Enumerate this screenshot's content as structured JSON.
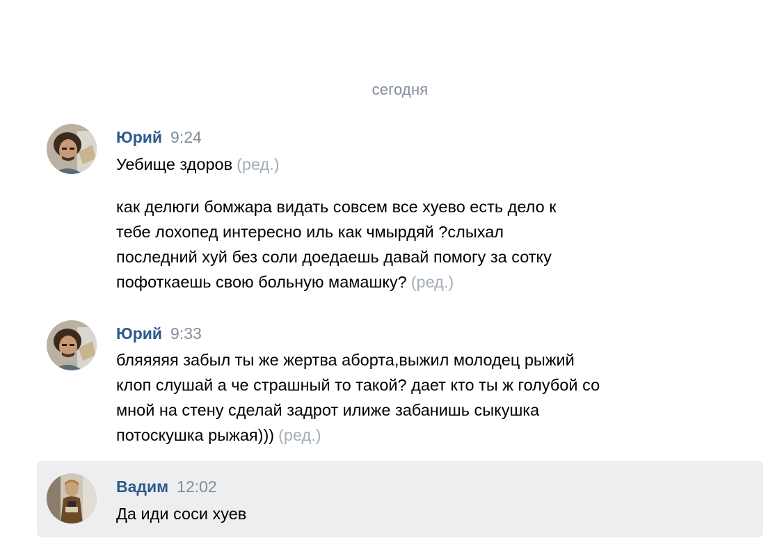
{
  "date_divider": "сегодня",
  "messages": [
    {
      "author": "Юрий",
      "time": "9:24",
      "texts": [
        {
          "text": "Уебище здоров",
          "edited": "(ред.)"
        },
        {
          "text": "как делюги бомжара видать совсем все хуево есть дело к\nтебе лохопед интересно иль как чмырдяй ?слыхал\nпоследний хуй без соли доедаешь давай помогу за сотку\nпофоткаешь свою больную мамашку?",
          "edited": "(ред.)"
        }
      ]
    },
    {
      "author": "Юрий",
      "time": "9:33",
      "texts": [
        {
          "text": "бляяяяя забыл ты же жертва аборта,выжил молодец рыжий\nклоп слушай а че страшный то такой? дает кто ты ж голубой со\nмной на стену сделай задрот илиже забанишь сыкушка\nпотоскушка рыжая)))",
          "edited": "(ред.)"
        }
      ]
    },
    {
      "author": "Вадим",
      "time": "12:02",
      "texts": [
        {
          "text": "Да иди соси хуев"
        }
      ]
    }
  ],
  "colors": {
    "author": "#2c5a8b",
    "meta": "#818c99",
    "edited": "#a4adb7",
    "highlight": "#edeef0"
  }
}
